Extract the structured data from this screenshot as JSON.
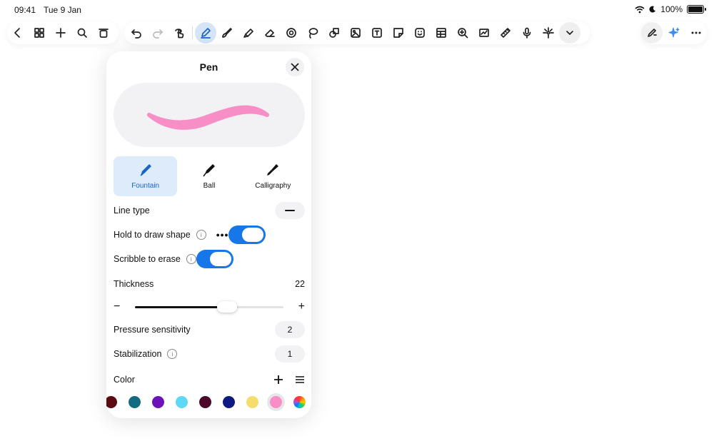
{
  "status": {
    "time": "09:41",
    "date": "Tue 9 Jan",
    "battery": "100%"
  },
  "toolbar_left": [
    {
      "name": "back-chevron-icon"
    },
    {
      "name": "grid-icon"
    },
    {
      "name": "plus-icon"
    },
    {
      "name": "search-icon"
    },
    {
      "name": "trash-icon"
    }
  ],
  "toolbar_main": [
    {
      "name": "undo-icon"
    },
    {
      "name": "redo-icon"
    },
    {
      "name": "hand-lasso-icon"
    },
    {
      "name": "pen-icon",
      "active": true
    },
    {
      "name": "brush-icon"
    },
    {
      "name": "highlighter-icon"
    },
    {
      "name": "eraser-icon"
    },
    {
      "name": "shape-recognize-icon"
    },
    {
      "name": "lasso-icon"
    },
    {
      "name": "shapes-icon"
    },
    {
      "name": "image-icon"
    },
    {
      "name": "text-box-icon"
    },
    {
      "name": "sticky-note-icon"
    },
    {
      "name": "sticker-icon"
    },
    {
      "name": "table-icon"
    },
    {
      "name": "zoom-icon"
    },
    {
      "name": "chart-icon"
    },
    {
      "name": "ruler-icon"
    },
    {
      "name": "microphone-icon"
    },
    {
      "name": "laser-pointer-icon"
    },
    {
      "name": "chevron-down-icon"
    }
  ],
  "panel": {
    "title": "Pen",
    "pen_types": [
      {
        "label": "Fountain",
        "selected": true
      },
      {
        "label": "Ball",
        "selected": false
      },
      {
        "label": "Calligraphy",
        "selected": false
      }
    ],
    "line_type_label": "Line type",
    "hold_to_draw_label": "Hold to draw shape",
    "hold_to_draw_on": true,
    "scribble_label": "Scribble to erase",
    "scribble_on": true,
    "thickness_label": "Thickness",
    "thickness_value": "22",
    "thickness_fraction": 0.62,
    "pressure_label": "Pressure sensitivity",
    "pressure_value": "2",
    "stabilization_label": "Stabilization",
    "stabilization_value": "1",
    "color_label": "Color",
    "stroke_color": "#f78fc6",
    "swatches": [
      "#5c0a12",
      "#136b7f",
      "#6b12b8",
      "#5fd8f5",
      "#4d0a28",
      "#0e1a82",
      "#f6dc6b",
      "#f78fc6",
      "rainbow"
    ],
    "selected_swatch": 7
  }
}
